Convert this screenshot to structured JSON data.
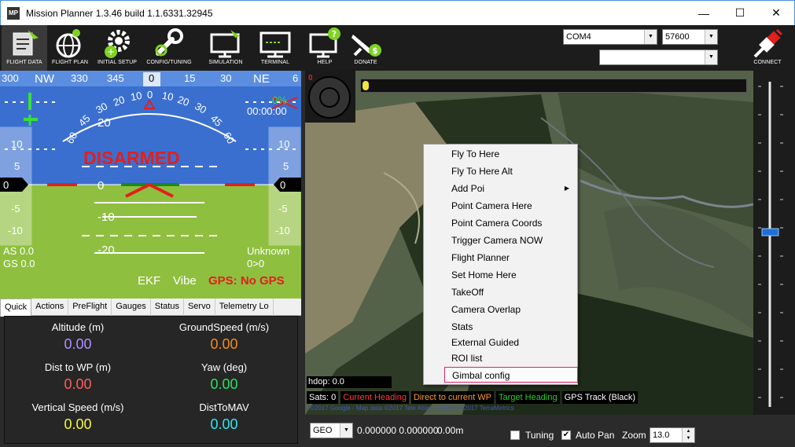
{
  "window": {
    "app_icon_text": "MP",
    "title": "Mission Planner 1.3.46 build 1.1.6331.32945",
    "minimize": "—",
    "maximize": "☐",
    "close": "✕"
  },
  "toolbar": {
    "items": [
      {
        "label": "FLIGHT DATA",
        "icon": "flight-data-icon"
      },
      {
        "label": "FLIGHT PLAN",
        "icon": "flight-plan-icon"
      },
      {
        "label": "INITIAL SETUP",
        "icon": "initial-setup-icon"
      },
      {
        "label": "CONFIG/TUNING",
        "icon": "config-tuning-icon"
      },
      {
        "label": "SIMULATION",
        "icon": "simulation-icon"
      },
      {
        "label": "TERMINAL",
        "icon": "terminal-icon"
      },
      {
        "label": "HELP",
        "icon": "help-icon"
      },
      {
        "label": "DONATE",
        "icon": "donate-icon"
      }
    ],
    "port": "COM4",
    "baud": "57600",
    "profile": "",
    "connect_label": "CONNECT"
  },
  "hud": {
    "heading_ticks": [
      "300",
      "NW",
      "330",
      "345",
      "0",
      "15",
      "30",
      "NE",
      "6"
    ],
    "pitch_labels_left": [
      "10",
      "5",
      "0",
      "-5",
      "-10"
    ],
    "pitch_labels_right": [
      "10",
      "5",
      "0",
      "-5",
      "-10"
    ],
    "center_pitch": [
      "20",
      "0",
      "-10",
      "-20"
    ],
    "roll_ticks": [
      "60",
      "45",
      "30",
      "20",
      "10",
      "0",
      "10",
      "20",
      "30",
      "45",
      "60"
    ],
    "status": "DISARMED",
    "as": "AS 0.0",
    "gs": "GS 0.0",
    "mode": "Unknown",
    "wp": "0>0",
    "battery": "0%",
    "time": "00:00:00",
    "ekf": "EKF",
    "vibe": "Vibe",
    "gps": "GPS: No GPS",
    "colors": {
      "sky": "#3a6fd0",
      "ground": "#8fbf3f",
      "warn": "#e0201e"
    }
  },
  "tabs": [
    "Quick",
    "Actions",
    "PreFlight",
    "Gauges",
    "Status",
    "Servo",
    "Telemetry Lo"
  ],
  "quick": [
    {
      "label": "Altitude (m)",
      "value": "0.00",
      "color": "#b28cff"
    },
    {
      "label": "GroundSpeed (m/s)",
      "value": "0.00",
      "color": "#f08a24"
    },
    {
      "label": "Dist to WP (m)",
      "value": "0.00",
      "color": "#ff5c5c"
    },
    {
      "label": "Yaw (deg)",
      "value": "0.00",
      "color": "#2ee05a"
    },
    {
      "label": "Vertical Speed (m/s)",
      "value": "0.00",
      "color": "#f5f542"
    },
    {
      "label": "DistToMAV",
      "value": "0.00",
      "color": "#33e6f0"
    }
  ],
  "map": {
    "hdop": "hdop: 0.0",
    "sats": "Sats: 0",
    "current_heading": "Current Heading",
    "direction_wp": "Direct to current WP",
    "target_heading": "Target Heading",
    "gps_track": "GPS Track (Black)",
    "copyright": "©2017 Google - Map data ©2017 Tele Atlas, Imagery ©2017 TerraMetrics",
    "compass_value": "0"
  },
  "context_menu": [
    "Fly To Here",
    "Fly To Here Alt",
    "Add Poi",
    "Point Camera Here",
    "Point Camera Coords",
    "Trigger Camera NOW",
    "Flight Planner",
    "Set Home Here",
    "TakeOff",
    "Camera Overlap",
    "Stats",
    "External Guided",
    "ROI list",
    "Gimbal config"
  ],
  "bottom": {
    "coord_system": "GEO",
    "coords": "0.000000 0.000000",
    "alt": "0.00m",
    "tuning_label": "Tuning",
    "tuning_checked": false,
    "autopan_label": "Auto Pan",
    "autopan_checked": true,
    "zoom_label": "Zoom",
    "zoom_value": "13.0"
  }
}
